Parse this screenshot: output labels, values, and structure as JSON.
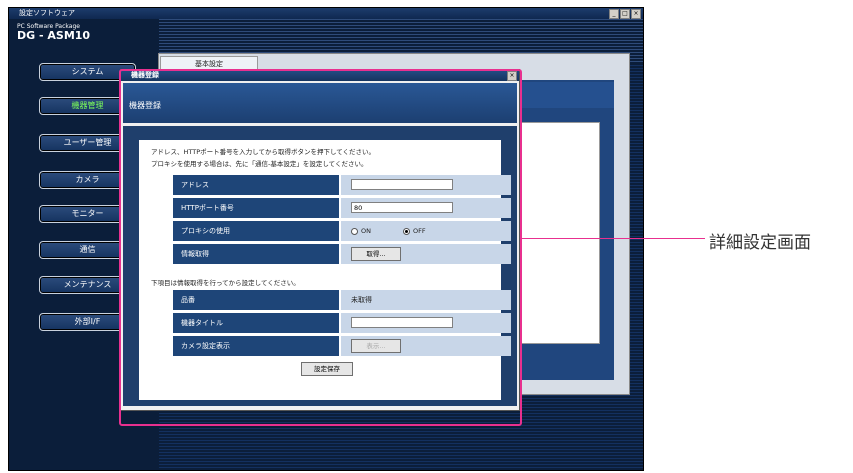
{
  "window": {
    "title": "設定ソフトウェア",
    "brand_line": "PC Software Package",
    "brand_model": "DG - ASM10",
    "min_label": "_",
    "max_label": "□",
    "close_label": "×"
  },
  "sidebar": {
    "items": [
      {
        "label": "システム",
        "active": false
      },
      {
        "label": "機器管理",
        "active": true
      },
      {
        "label": "ユーザー管理",
        "active": false
      },
      {
        "label": "カメラ",
        "active": false
      },
      {
        "label": "モニター",
        "active": false
      },
      {
        "label": "通信",
        "active": false
      },
      {
        "label": "メンテナンス",
        "active": false
      },
      {
        "label": "外部I/F",
        "active": false
      }
    ]
  },
  "background": {
    "tab_label": "基本設定"
  },
  "dialog": {
    "title": "機器登録",
    "close_label": "×",
    "header": "機器登録",
    "note1": "アドレス、HTTPポート番号を入力してから取得ボタンを押下してください。",
    "note2": "プロキシを使用する場合は、先に「通信-基本設定」を設定してください。",
    "address_label": "アドレス",
    "address_value": "",
    "http_port_label": "HTTPポート番号",
    "http_port_value": "80",
    "proxy_label": "プロキシの使用",
    "proxy_on": "ON",
    "proxy_off": "OFF",
    "proxy_selected": "OFF",
    "info_label": "情報取得",
    "info_button": "取得...",
    "note3": "下項目は情報取得を行ってから設定してください。",
    "model_label": "品番",
    "model_value": "未取得",
    "device_title_label": "機器タイトル",
    "device_title_value": "",
    "camera_display_label": "カメラ設定表示",
    "camera_display_button": "表示...",
    "save_button": "設定保存"
  },
  "callout": {
    "label": "詳細設定画面",
    "color": "#e8308f"
  }
}
